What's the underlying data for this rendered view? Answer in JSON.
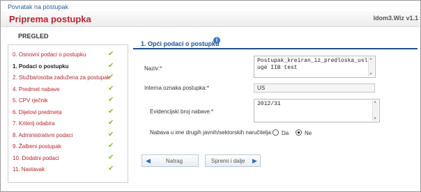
{
  "back_link": "Povratak na postupak",
  "header": {
    "title": "Priprema postupka",
    "right_text": "Idom3.Wiz v1.1"
  },
  "sidebar": {
    "heading": "PREGLED",
    "items": [
      {
        "label": "0. Osnovni podaci o postupku"
      },
      {
        "label": "1. Podaci o postupku"
      },
      {
        "label": "2. Služba/osoba zadužena za postupak"
      },
      {
        "label": "4. Predmet nabave"
      },
      {
        "label": "5. CPV rječnik"
      },
      {
        "label": "6. Dijelovi predmeta"
      },
      {
        "label": "7. Kriterij odabira"
      },
      {
        "label": "8. Administrativni podaci"
      },
      {
        "label": "9. Žalbeni postupak"
      },
      {
        "label": "10. Dodatni podaci"
      },
      {
        "label": "11. Nastavak"
      }
    ],
    "check_icon": "check-icon"
  },
  "section": {
    "title": "1. Opći podaci o postupku",
    "help_icon": "help-icon"
  },
  "form": {
    "naziv_label": "Naziv:*",
    "naziv_value": "Postupak_kreiran_iz_predloska_usl uge IIB test",
    "interna_label": "Interna oznaka postupka:*",
    "interna_value": "US",
    "evidencijski_label": "Evidencijski broj nabave:*",
    "evidencijski_value": "2012/31",
    "nabava_label": "Nabava u ime drugih javnih/sektorskih naručitelja:",
    "radio_da": "Da",
    "radio_ne": "Ne",
    "radio_selected": "Ne"
  },
  "buttons": {
    "back": "Natrag",
    "save_next": "Spremi i dalje"
  },
  "colors": {
    "accent_red": "#b5262d",
    "accent_blue": "#1d4f8e",
    "check_green": "#8bbb33"
  }
}
